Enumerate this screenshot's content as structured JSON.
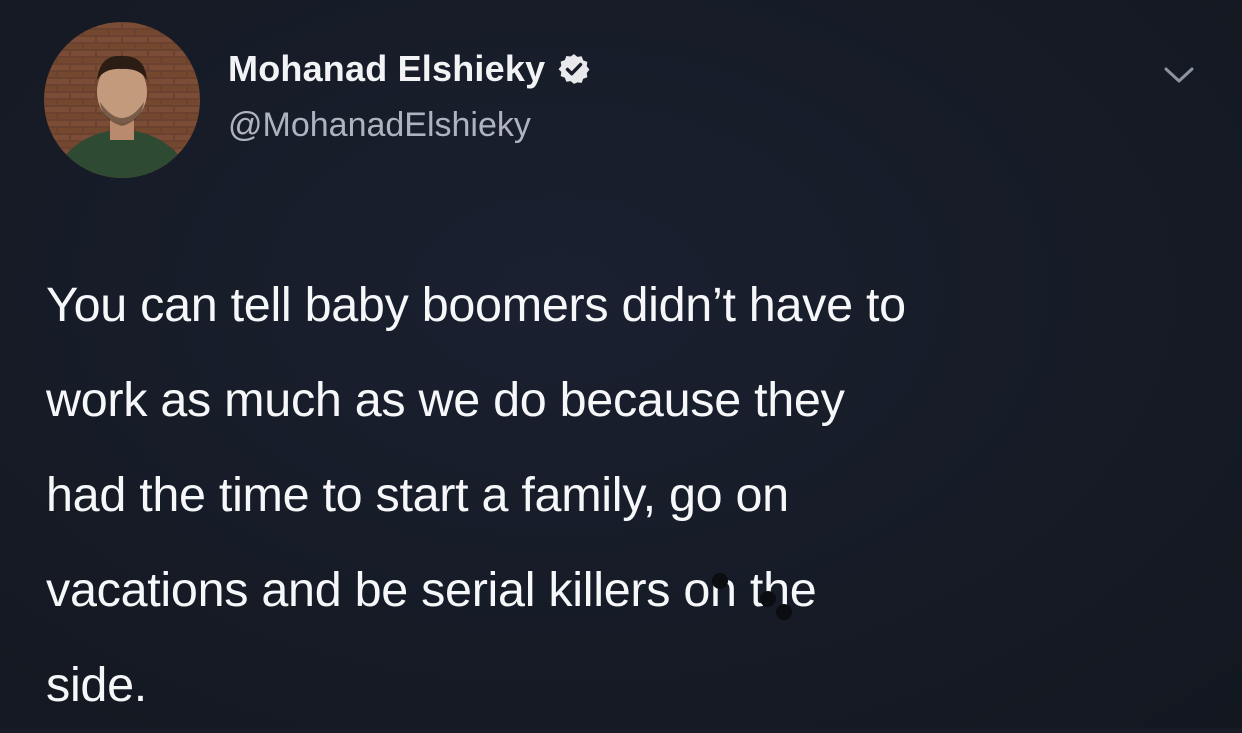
{
  "tweet": {
    "display_name": "Mohanad Elshieky",
    "handle": "@MohanadElshieky",
    "verified": true,
    "text": "You can tell baby boomers didn’t have to\nwork as much as we do because they\nhad the time to start a family, go on\nvacations and be serial killers on the\nside."
  },
  "icons": {
    "verified": "verified-badge-icon",
    "menu": "chevron-down-icon",
    "avatar": "profile-photo"
  },
  "colors": {
    "background": "#161b26",
    "name": "#f2f3f5",
    "handle": "#aeb4bf",
    "text": "#f6f7f9",
    "verified_badge": "#e8e9ec"
  }
}
